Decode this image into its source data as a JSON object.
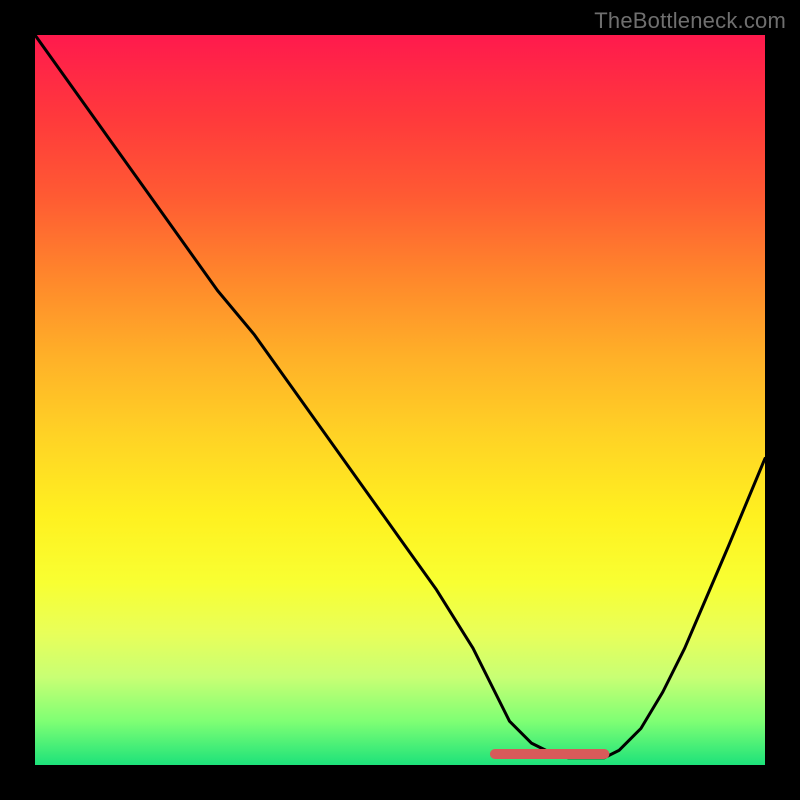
{
  "watermark": "TheBottleneck.com",
  "chart_data": {
    "type": "line",
    "title": "",
    "xlabel": "",
    "ylabel": "",
    "xlim": [
      0,
      100
    ],
    "ylim": [
      0,
      100
    ],
    "grid": false,
    "legend": false,
    "series": [
      {
        "name": "bottleneck-curve",
        "color": "#000000",
        "x": [
          0,
          5,
          10,
          15,
          20,
          25,
          30,
          35,
          40,
          45,
          50,
          55,
          60,
          63,
          65,
          68,
          70,
          73,
          76,
          78,
          80,
          83,
          86,
          89,
          92,
          95,
          100
        ],
        "y": [
          100,
          93,
          86,
          79,
          72,
          65,
          59,
          52,
          45,
          38,
          31,
          24,
          16,
          10,
          6,
          3,
          2,
          1,
          1,
          1,
          2,
          5,
          10,
          16,
          23,
          30,
          42
        ]
      }
    ],
    "highlight": {
      "name": "red-segment",
      "color": "#d85a5a",
      "x": [
        63,
        78
      ],
      "y": [
        1.5,
        1.5
      ]
    },
    "highlight_end_dot": {
      "x": 78,
      "y": 1.5,
      "r": 4.5,
      "color": "#d85a5a"
    },
    "background_gradient_stops": [
      {
        "pos": 0.0,
        "color": "#ff1a4d"
      },
      {
        "pos": 0.12,
        "color": "#ff3b3b"
      },
      {
        "pos": 0.22,
        "color": "#ff5a33"
      },
      {
        "pos": 0.34,
        "color": "#ff8a2b"
      },
      {
        "pos": 0.44,
        "color": "#ffb028"
      },
      {
        "pos": 0.55,
        "color": "#ffd325"
      },
      {
        "pos": 0.66,
        "color": "#fff120"
      },
      {
        "pos": 0.75,
        "color": "#f8ff32"
      },
      {
        "pos": 0.82,
        "color": "#e8ff5a"
      },
      {
        "pos": 0.88,
        "color": "#c8ff74"
      },
      {
        "pos": 0.94,
        "color": "#7fff74"
      },
      {
        "pos": 1.0,
        "color": "#1de27a"
      }
    ]
  }
}
